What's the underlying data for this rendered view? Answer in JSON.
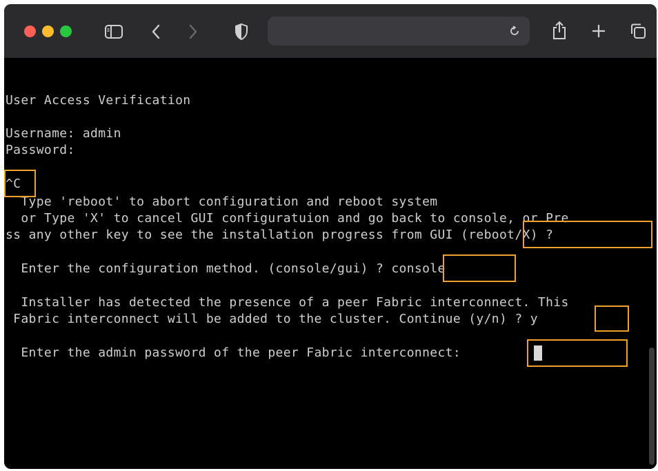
{
  "browser": {
    "address_bar": {
      "placeholder": ""
    },
    "icons": {
      "sidebar": "sidebar-icon",
      "back": "chevron-left-icon",
      "forward": "chevron-right-icon",
      "privacy": "shield-icon",
      "reload": "reload-icon",
      "share": "share-icon",
      "new_tab": "plus-icon",
      "tabs": "tab-overview-icon"
    },
    "colors": {
      "toolbar": "#2b2a2d",
      "close": "#fe5f57",
      "minimize": "#febc2e",
      "zoom": "#28c840"
    }
  },
  "terminal": {
    "lines": {
      "title": "User Access Verification",
      "username": "Username: admin",
      "password": "Password:",
      "ctrl_c": "^C",
      "reboot_1": "  Type 'reboot' to abort configuration and reboot system",
      "reboot_2": "  or Type 'X' to cancel GUI configuratuion and go back to console, or Pre",
      "reboot_3": "ss any other key to see the installation progress from GUI (reboot/X) ?",
      "config_method": "  Enter the configuration method. (console/gui) ? console",
      "peer_1": "  Installer has detected the presence of a peer Fabric interconnect. This",
      "peer_2": " Fabric interconnect will be added to the cluster. Continue (y/n) ? y",
      "admin_password": "  Enter the admin password of the peer Fabric interconnect: "
    },
    "colors": {
      "background": "#000000",
      "text": "#cfcfcf",
      "highlight": "#f0a22c"
    }
  }
}
